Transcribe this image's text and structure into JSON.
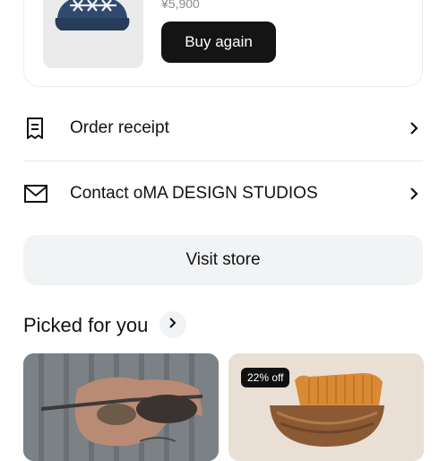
{
  "product": {
    "price": "¥5,900",
    "buy_again_label": "Buy again"
  },
  "rows": {
    "receipt": {
      "label": "Order receipt",
      "icon": "receipt-icon"
    },
    "contact": {
      "label": "Contact oMA DESIGN STUDIOS",
      "icon": "mail-icon"
    }
  },
  "visit_store_label": "Visit store",
  "picked": {
    "title": "Picked for you",
    "items": [
      {
        "badge": ""
      },
      {
        "badge": "22% off"
      }
    ]
  },
  "colors": {
    "primary_button": "#141414",
    "secondary_button": "#f1f3f5",
    "divider": "#e7e7e7"
  }
}
